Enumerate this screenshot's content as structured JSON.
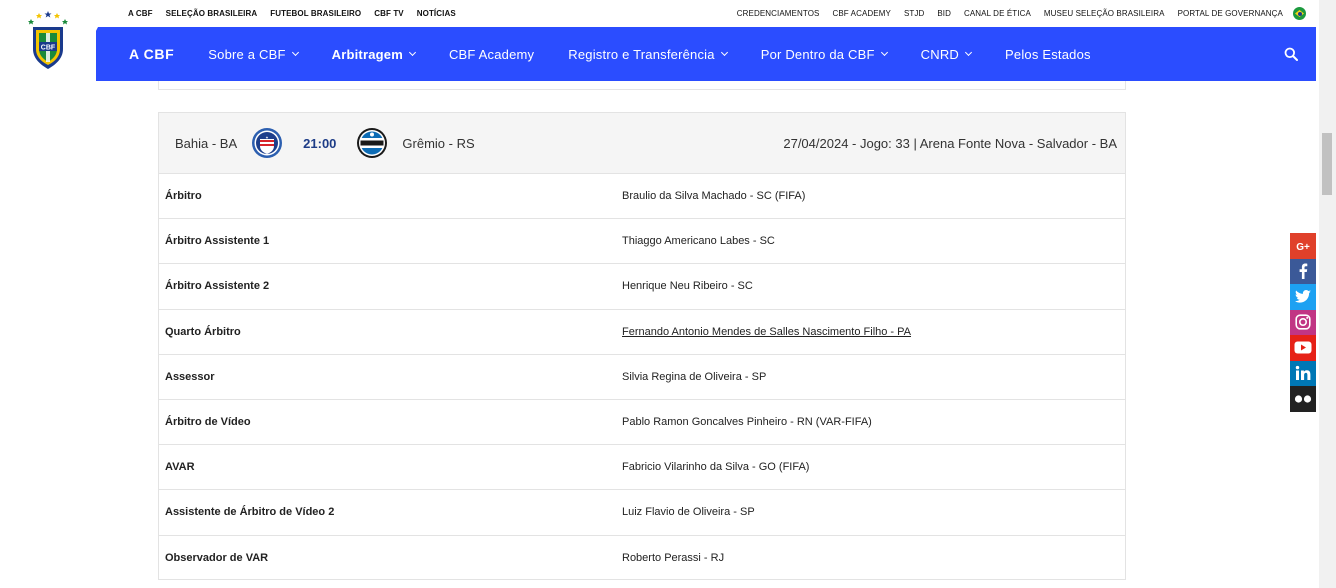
{
  "header": {
    "top_links_left": [
      "A CBF",
      "SELEÇÃO BRASILEIRA",
      "FUTEBOL BRASILEIRO",
      "CBF TV",
      "NOTÍCIAS"
    ],
    "top_links_right": [
      "CREDENCIAMENTOS",
      "CBF ACADEMY",
      "STJD",
      "BID",
      "CANAL DE ÉTICA",
      "MUSEU SELEÇÃO BRASILEIRA",
      "PORTAL DE GOVERNANÇA"
    ],
    "logo_text": "CBF",
    "nav": {
      "brand": "A CBF",
      "items": [
        {
          "label": "Sobre a CBF",
          "has_dropdown": true
        },
        {
          "label": "Arbitragem",
          "has_dropdown": true,
          "active": true
        },
        {
          "label": "CBF Academy",
          "has_dropdown": false
        },
        {
          "label": "Registro e Transferência",
          "has_dropdown": true
        },
        {
          "label": "Por Dentro da CBF",
          "has_dropdown": true
        },
        {
          "label": "CNRD",
          "has_dropdown": true
        },
        {
          "label": "Pelos Estados",
          "has_dropdown": false
        }
      ]
    },
    "colors": {
      "nav_bg": "#2b4dff",
      "score": "#1d3c87"
    }
  },
  "social": [
    "google-plus-icon",
    "facebook-icon",
    "twitter-icon",
    "instagram-icon",
    "youtube-icon",
    "linkedin-icon",
    "flickr-icon"
  ],
  "match": {
    "home_team": "Bahia - BA",
    "time": "21:00",
    "away_team": "Grêmio - RS",
    "info": "27/04/2024 - Jogo: 33 | Arena Fonte Nova - Salvador - BA",
    "officials": [
      {
        "role": "Árbitro",
        "name": "Braulio da Silva Machado - SC (FIFA)",
        "link": false
      },
      {
        "role": "Árbitro Assistente 1",
        "name": "Thiaggo Americano Labes - SC",
        "link": false
      },
      {
        "role": "Árbitro Assistente 2",
        "name": "Henrique Neu Ribeiro - SC",
        "link": false
      },
      {
        "role": "Quarto Árbitro",
        "name": "Fernando Antonio Mendes de Salles Nascimento Filho - PA",
        "link": true
      },
      {
        "role": "Assessor",
        "name": "Silvia Regina de Oliveira - SP",
        "link": false
      },
      {
        "role": "Árbitro de Vídeo",
        "name": "Pablo Ramon Goncalves Pinheiro - RN (VAR-FIFA)",
        "link": false
      },
      {
        "role": "AVAR",
        "name": "Fabricio Vilarinho da Silva - GO (FIFA)",
        "link": false
      },
      {
        "role": "Assistente de Árbitro de Vídeo 2",
        "name": "Luiz Flavio de Oliveira - SP",
        "link": false
      },
      {
        "role": "Observador de VAR",
        "name": "Roberto Perassi - RJ",
        "link": false
      }
    ]
  }
}
